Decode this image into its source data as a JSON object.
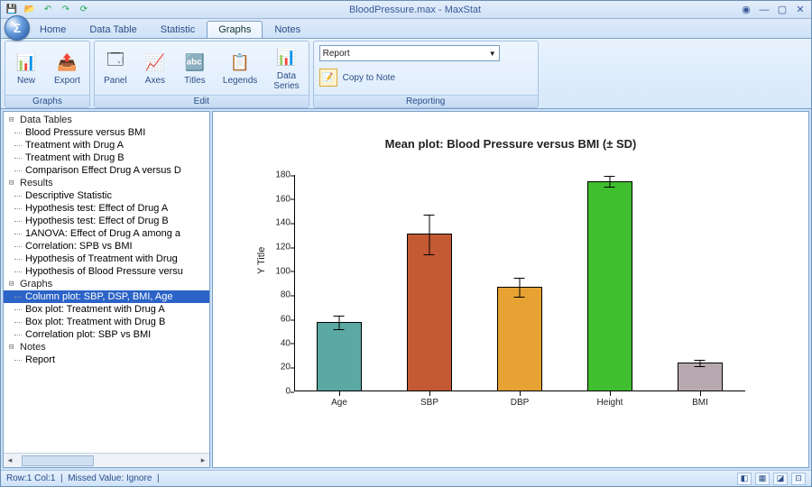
{
  "window": {
    "title": "BloodPressure.max - MaxStat",
    "orb": "Σ"
  },
  "menu": {
    "tabs": [
      "Home",
      "Data Table",
      "Statistic",
      "Graphs",
      "Notes"
    ],
    "active": "Graphs"
  },
  "ribbon": {
    "groups": [
      {
        "label": "Graphs",
        "buttons": [
          {
            "name": "new-button",
            "icon": "📊",
            "label": "New"
          },
          {
            "name": "export-button",
            "icon": "📤",
            "label": "Export"
          }
        ]
      },
      {
        "label": "Edit",
        "buttons": [
          {
            "name": "panel-button",
            "icon": "🗔",
            "label": "Panel"
          },
          {
            "name": "axes-button",
            "icon": "📈",
            "label": "Axes"
          },
          {
            "name": "titles-button",
            "icon": "🔤",
            "label": "Titles"
          },
          {
            "name": "legends-button",
            "icon": "📋",
            "label": "Legends"
          },
          {
            "name": "data-series-button",
            "icon": "📊",
            "label": "Data\nSeries"
          }
        ]
      },
      {
        "label": "Reporting",
        "combo": "Report",
        "copy_label": "Copy to Note"
      }
    ]
  },
  "tree": {
    "sections": [
      {
        "title": "Data Tables",
        "items": [
          "Blood Pressure versus BMI",
          "Treatment with Drug A",
          "Treatment with Drug B",
          "Comparison Effect Drug A versus D"
        ]
      },
      {
        "title": "Results",
        "items": [
          "Descriptive Statistic",
          "Hypothesis test: Effect of Drug A",
          "Hypothesis test: Effect of Drug B",
          "1ANOVA: Effect of Drug A among a",
          "Correlation: SPB vs BMI",
          "Hypothesis of Treatment with Drug",
          "Hypothesis of Blood Pressure versu"
        ]
      },
      {
        "title": "Graphs",
        "selected": 0,
        "items": [
          "Column plot: SBP, DSP, BMI, Age",
          "Box plot: Treatment with Drug A",
          "Box plot: Treatment with Drug B",
          "Correlation plot: SBP vs BMI"
        ]
      },
      {
        "title": "Notes",
        "items": [
          "Report"
        ]
      }
    ]
  },
  "status": {
    "left_1": "Row:1 Col:1",
    "left_2": "Missed Value: Ignore"
  },
  "chart_data": {
    "type": "bar",
    "title": "Mean plot: Blood Pressure versus BMI (± SD)",
    "ylabel": "Y Title",
    "xlabel": "",
    "ylim": [
      0,
      180
    ],
    "yticks": [
      0,
      20,
      40,
      60,
      80,
      100,
      120,
      140,
      160,
      180
    ],
    "categories": [
      "Age",
      "SBP",
      "DBP",
      "Height",
      "BMI"
    ],
    "values": [
      58,
      131,
      87,
      175,
      24
    ],
    "sd": [
      6,
      17,
      8,
      5,
      3
    ],
    "colors": [
      "#5aa9a3",
      "#c45a33",
      "#e6a233",
      "#3fbf2f",
      "#b8a9b0"
    ]
  }
}
